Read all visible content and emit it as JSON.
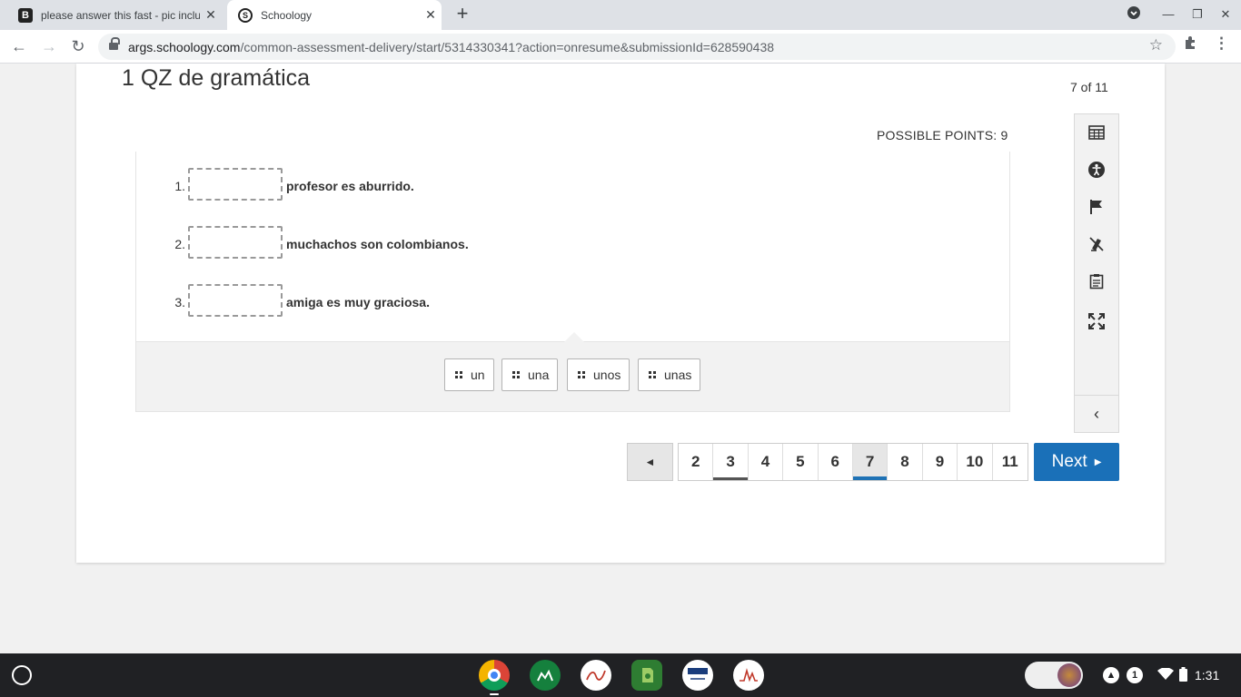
{
  "browser": {
    "tabs": [
      {
        "title": "please answer this fast - pic included",
        "favicon": "B",
        "active": false
      },
      {
        "title": "Schoology",
        "favicon": "S",
        "active": true
      }
    ],
    "url_host": "args.schoology.com",
    "url_path": "/common-assessment-delivery/start/5314330341?action=onresume&submissionId=628590438"
  },
  "quiz": {
    "title": "1 QZ de gramática",
    "progress": "7 of 11",
    "possible_points": "POSSIBLE POINTS: 9",
    "items": [
      {
        "number": "1.",
        "text": "profesor es aburrido."
      },
      {
        "number": "2.",
        "text": "muchachos son colombianos."
      },
      {
        "number": "3.",
        "text": "amiga es muy graciosa."
      }
    ],
    "word_bank": [
      "un",
      "una",
      "unos",
      "unas"
    ]
  },
  "tools": [
    "calculator-icon",
    "accessibility-icon",
    "flag-icon",
    "no-highlight-icon",
    "notepad-icon",
    "fullscreen-icon"
  ],
  "pagination": {
    "prev_label": "◄",
    "pages": [
      "2",
      "3",
      "4",
      "5",
      "6",
      "7",
      "8",
      "9",
      "10",
      "11"
    ],
    "current": "7",
    "answered": [
      "3"
    ],
    "next_label": "Next"
  },
  "shelf": {
    "apps": [
      "chrome-icon",
      "classroom-icon",
      "app-icon",
      "evernote-icon",
      "pearson-techbook-icon",
      "chart-app-icon"
    ],
    "time": "1:31",
    "notification_count": "1"
  },
  "colors": {
    "accent": "#1a70b8",
    "tabbar": "#dee1e6",
    "shelf": "#202124"
  }
}
